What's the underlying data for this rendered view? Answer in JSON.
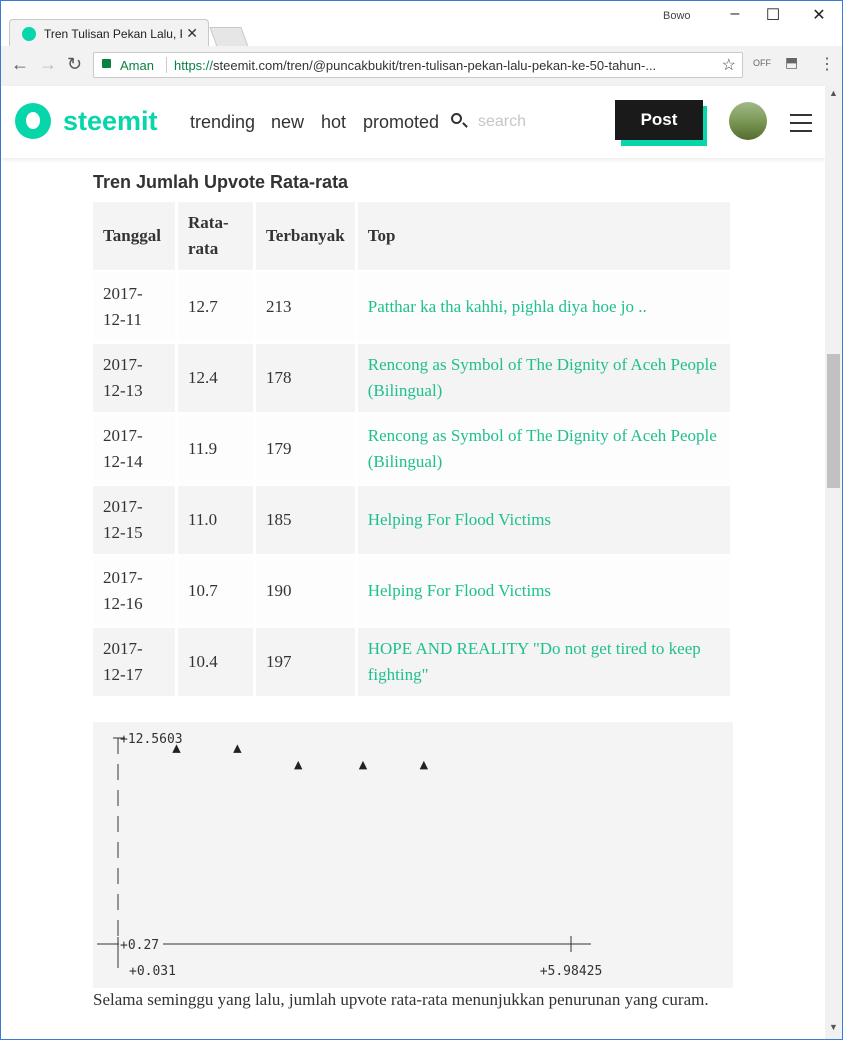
{
  "browser": {
    "tab_title": "Tren Tulisan Pekan Lalu, P",
    "user": "Bowo",
    "security_label": "Aman",
    "url_scheme": "https://",
    "url_rest": "steemit.com/tren/@puncakbukit/tren-tulisan-pekan-lalu-pekan-ke-50-tahun-...",
    "ext_off": "OFF"
  },
  "header": {
    "logo": "steemit",
    "nav": [
      "trending",
      "new",
      "hot",
      "promoted"
    ],
    "search_placeholder": "search",
    "post_label": "Post"
  },
  "section": {
    "heading": "Tren Jumlah Upvote Rata-rata",
    "columns": [
      "Tanggal",
      "Rata-rata",
      "Terbanyak",
      "Top"
    ],
    "rows": [
      {
        "date": "2017-12-11",
        "avg": "12.7",
        "max": "213",
        "top": "Patthar ka tha kahhi, pighla diya hoe jo .."
      },
      {
        "date": "2017-12-13",
        "avg": "12.4",
        "max": "178",
        "top": "Rencong as Symbol of The Dignity of Aceh People (Bilingual)"
      },
      {
        "date": "2017-12-14",
        "avg": "11.9",
        "max": "179",
        "top": "Rencong as Symbol of The Dignity of Aceh People (Bilingual)"
      },
      {
        "date": "2017-12-15",
        "avg": "11.0",
        "max": "185",
        "top": "Helping For Flood Victims"
      },
      {
        "date": "2017-12-16",
        "avg": "10.7",
        "max": "190",
        "top": "Helping For Flood Victims"
      },
      {
        "date": "2017-12-17",
        "avg": "10.4",
        "max": "197",
        "top": "HOPE AND REALITY \"Do not get tired to keep fighting\""
      }
    ],
    "summary": "Selama seminggu yang lalu, jumlah upvote rata-rata menunjukkan penurunan yang curam."
  },
  "chart_data": {
    "type": "scatter",
    "marker": "▲",
    "y_top_label": "+12.5603",
    "y_bottom_label": "+0.27",
    "x_left_label": "+0.031",
    "x_right_label": "+5.98425",
    "ylim": [
      0.27,
      12.5603
    ],
    "xlim": [
      0.031,
      5.98425
    ],
    "x": [
      0.8,
      1.6,
      2.4,
      3.25,
      4.05
    ],
    "y": [
      12.0,
      12.0,
      11.0,
      11.0,
      11.0
    ]
  }
}
